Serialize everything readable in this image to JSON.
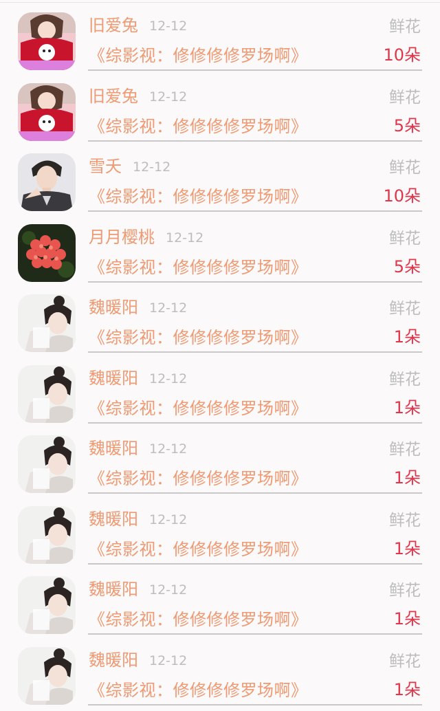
{
  "gift_list": {
    "rows": [
      {
        "name": "旧爱兔",
        "date": "12-12",
        "gift_label": "鲜花",
        "book": "《综影视：修修修修罗场啊》",
        "count": "10朵",
        "avatar": "avatar-girl-red-sweater"
      },
      {
        "name": "旧爱兔",
        "date": "12-12",
        "gift_label": "鲜花",
        "book": "《综影视：修修修修罗场啊》",
        "count": "5朵",
        "avatar": "avatar-girl-red-sweater"
      },
      {
        "name": "雪夭",
        "date": "12-12",
        "gift_label": "鲜花",
        "book": "《综影视：修修修修罗场啊》",
        "count": "10朵",
        "avatar": "avatar-man-portrait"
      },
      {
        "name": "月月樱桃",
        "date": "12-12",
        "gift_label": "鲜花",
        "book": "《综影视：修修修修罗场啊》",
        "count": "5朵",
        "avatar": "avatar-red-flowers"
      },
      {
        "name": "魏暖阳",
        "date": "12-12",
        "gift_label": "鲜花",
        "book": "《综影视：修修修修罗场啊》",
        "count": "1朵",
        "avatar": "avatar-girl-bun"
      },
      {
        "name": "魏暖阳",
        "date": "12-12",
        "gift_label": "鲜花",
        "book": "《综影视：修修修修罗场啊》",
        "count": "1朵",
        "avatar": "avatar-girl-bun"
      },
      {
        "name": "魏暖阳",
        "date": "12-12",
        "gift_label": "鲜花",
        "book": "《综影视：修修修修罗场啊》",
        "count": "1朵",
        "avatar": "avatar-girl-bun"
      },
      {
        "name": "魏暖阳",
        "date": "12-12",
        "gift_label": "鲜花",
        "book": "《综影视：修修修修罗场啊》",
        "count": "1朵",
        "avatar": "avatar-girl-bun"
      },
      {
        "name": "魏暖阳",
        "date": "12-12",
        "gift_label": "鲜花",
        "book": "《综影视：修修修修罗场啊》",
        "count": "1朵",
        "avatar": "avatar-girl-bun"
      },
      {
        "name": "魏暖阳",
        "date": "12-12",
        "gift_label": "鲜花",
        "book": "《综影视：修修修修罗场啊》",
        "count": "1朵",
        "avatar": "avatar-girl-bun"
      }
    ]
  },
  "colors": {
    "name_and_book": "#ef9a72",
    "count": "#e0364b",
    "muted": "#bdbdbd",
    "separator": "#c9c7c8"
  }
}
